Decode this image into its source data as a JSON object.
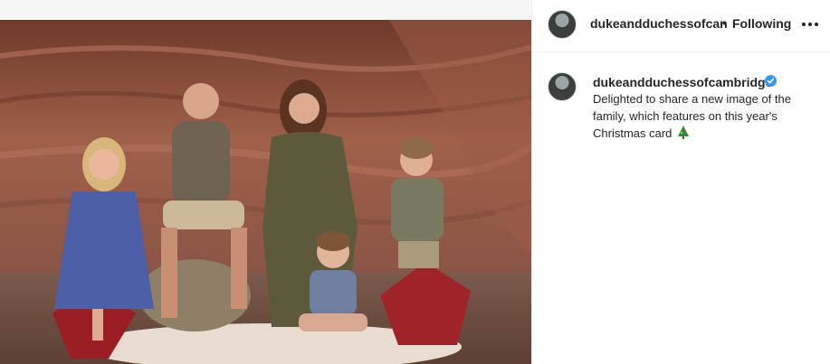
{
  "post": {
    "image_alt": "Family seated in front of red sandstone rock",
    "colors": {
      "rock": "#8a4f3a",
      "verified": "#3897f0",
      "text": "#262626"
    }
  },
  "header": {
    "avatar_icon": "profile-avatar",
    "username": "dukeandduchessofcan",
    "separator": "•",
    "follow_label": "Following",
    "more_icon": "more-options-icon"
  },
  "caption": {
    "username": "dukeandduchessofcambridge",
    "verified_icon": "verified-badge-icon",
    "text": "Delighted to share a new image of the family, which features on this year's Christmas card",
    "emoji": "christmas-tree-icon"
  }
}
